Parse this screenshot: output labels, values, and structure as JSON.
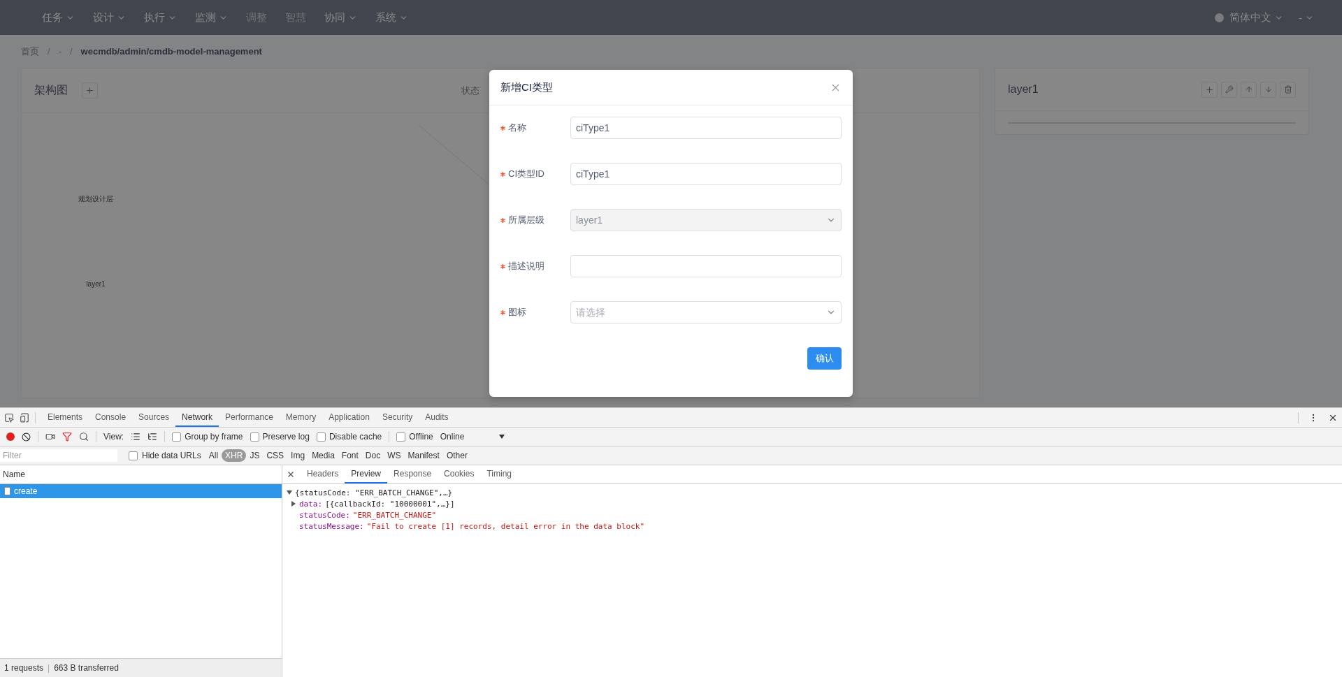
{
  "nav": {
    "items": [
      {
        "label": "任务",
        "dropdown": true,
        "disabled": false
      },
      {
        "label": "设计",
        "dropdown": true,
        "disabled": false
      },
      {
        "label": "执行",
        "dropdown": true,
        "disabled": false
      },
      {
        "label": "监测",
        "dropdown": true,
        "disabled": false
      },
      {
        "label": "调整",
        "dropdown": false,
        "disabled": true
      },
      {
        "label": "智慧",
        "dropdown": false,
        "disabled": true
      },
      {
        "label": "协同",
        "dropdown": true,
        "disabled": false
      },
      {
        "label": "系统",
        "dropdown": true,
        "disabled": false
      }
    ],
    "language": "简体中文",
    "user": "-"
  },
  "breadcrumb": {
    "separator": "/",
    "items": [
      "首页",
      "-",
      "wecmdb/admin/cmdb-model-management"
    ]
  },
  "diagram_panel": {
    "title": "架构图",
    "status_label": "状态",
    "nodes": [
      {
        "label": "规划设计层"
      },
      {
        "label": "layer1"
      }
    ]
  },
  "layer_panel": {
    "title": "layer1"
  },
  "modal": {
    "title": "新增CI类型",
    "fields": [
      {
        "label": "名称",
        "required": true,
        "kind": "input",
        "value": "ciType1"
      },
      {
        "label": "CI类型ID",
        "required": true,
        "kind": "input",
        "value": "ciType1"
      },
      {
        "label": "所属层级",
        "required": true,
        "kind": "select",
        "value": "layer1",
        "disabled": true
      },
      {
        "label": "描述说明",
        "required": true,
        "kind": "input"
      },
      {
        "label": "图标",
        "required": true,
        "kind": "select",
        "placeholder": "请选择",
        "disabled": false
      }
    ],
    "submit": "确认"
  },
  "devtools": {
    "tabs": [
      {
        "label": "Elements",
        "selected": false
      },
      {
        "label": "Console",
        "selected": false
      },
      {
        "label": "Sources",
        "selected": false
      },
      {
        "label": "Network",
        "selected": true
      },
      {
        "label": "Performance",
        "selected": false
      },
      {
        "label": "Memory",
        "selected": false
      },
      {
        "label": "Application",
        "selected": false
      },
      {
        "label": "Security",
        "selected": false
      },
      {
        "label": "Audits",
        "selected": false
      }
    ],
    "toolbar": {
      "recording": true,
      "view_label": "View:",
      "options": [
        {
          "label": "Group by frame",
          "checked": false
        },
        {
          "label": "Preserve log",
          "checked": false
        },
        {
          "label": "Disable cache",
          "checked": false
        }
      ],
      "offline": {
        "label": "Offline",
        "checked": false
      },
      "throttle": "Online"
    },
    "filter": {
      "placeholder": "Filter",
      "hide_data_urls": {
        "label": "Hide data URLs",
        "checked": false
      },
      "types": [
        {
          "label": "All",
          "selected": false
        },
        {
          "label": "XHR",
          "selected": true
        },
        {
          "label": "JS",
          "selected": false
        },
        {
          "label": "CSS",
          "selected": false
        },
        {
          "label": "Img",
          "selected": false
        },
        {
          "label": "Media",
          "selected": false
        },
        {
          "label": "Font",
          "selected": false
        },
        {
          "label": "Doc",
          "selected": false
        },
        {
          "label": "WS",
          "selected": false
        },
        {
          "label": "Manifest",
          "selected": false
        },
        {
          "label": "Other",
          "selected": false
        }
      ]
    },
    "requests": {
      "header": "Name",
      "rows": [
        {
          "name": "create",
          "selected": true
        }
      ]
    },
    "detail_tabs": [
      {
        "label": "Headers",
        "selected": false
      },
      {
        "label": "Preview",
        "selected": true
      },
      {
        "label": "Response",
        "selected": false
      },
      {
        "label": "Cookies",
        "selected": false
      },
      {
        "label": "Timing",
        "selected": false
      }
    ],
    "preview": {
      "summary": "{statusCode: \"ERR_BATCH_CHANGE\",…}",
      "expanded": true,
      "children": [
        {
          "key": "data:",
          "value": "[{callbackId: \"10000001\",…}]",
          "kind": "object",
          "expanded": false
        },
        {
          "key": "statusCode:",
          "value": "\"ERR_BATCH_CHANGE\"",
          "kind": "string"
        },
        {
          "key": "statusMessage:",
          "value": "\"Fail to create [1] records, detail error in the data block\"",
          "kind": "string"
        }
      ]
    },
    "status": {
      "requests": "1 requests",
      "separator": "|",
      "transferred": "663 B transferred"
    }
  }
}
